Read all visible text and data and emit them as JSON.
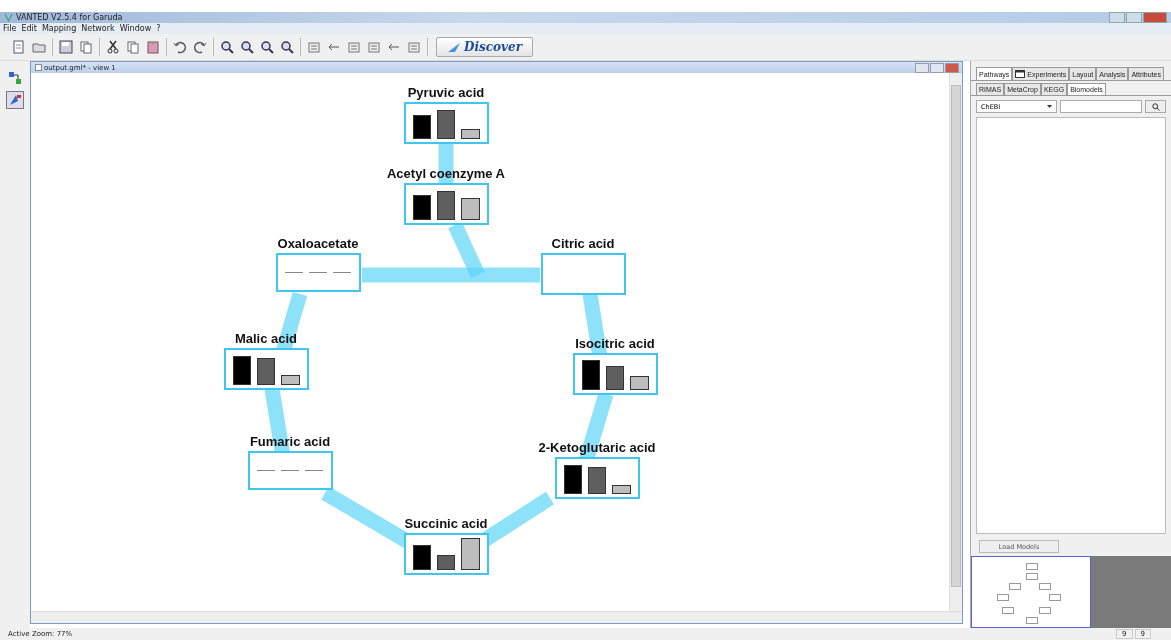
{
  "window": {
    "title": "VANTED V2.5.4 for Garuda"
  },
  "menu": [
    "File",
    "Edit",
    "Mapping",
    "Network",
    "Window",
    "?"
  ],
  "toolbar": {
    "discover": "Discover"
  },
  "left_tools": [
    {
      "selected": false
    },
    {
      "selected": true
    }
  ],
  "view": {
    "title": "output.gml* - view 1",
    "nodes": [
      {
        "label": "Pyruvic acid",
        "kind": "bars"
      },
      {
        "label": "Acetyl coenzyme A",
        "kind": "bars"
      },
      {
        "label": "Oxaloacetate",
        "kind": "dashes"
      },
      {
        "label": "Citric acid",
        "kind": "empty"
      },
      {
        "label": "Malic acid",
        "kind": "bars"
      },
      {
        "label": "Isocitric acid",
        "kind": "bars"
      },
      {
        "label": "Fumaric acid",
        "kind": "dashes"
      },
      {
        "label": "2-Ketoglutaric acid",
        "kind": "bars"
      },
      {
        "label": "Succinic acid",
        "kind": "bars"
      }
    ]
  },
  "side_panel": {
    "tabs": [
      {
        "label": "Pathways",
        "selected": true
      },
      {
        "label": "Experiments",
        "selected": false
      },
      {
        "label": "Layout",
        "selected": false
      },
      {
        "label": "Analysis",
        "selected": false
      },
      {
        "label": "Attributes",
        "selected": false
      }
    ],
    "subtabs": [
      {
        "label": "RIMAS",
        "selected": false
      },
      {
        "label": "MetaCrop",
        "selected": false
      },
      {
        "label": "KEGG",
        "selected": false
      },
      {
        "label": "Biomodels",
        "selected": true
      }
    ],
    "database": "ChEBI",
    "load_button": "Load Models"
  },
  "status_bar": {
    "zoom": "Active Zoom: 77%",
    "fields": [
      "9",
      "9"
    ]
  }
}
